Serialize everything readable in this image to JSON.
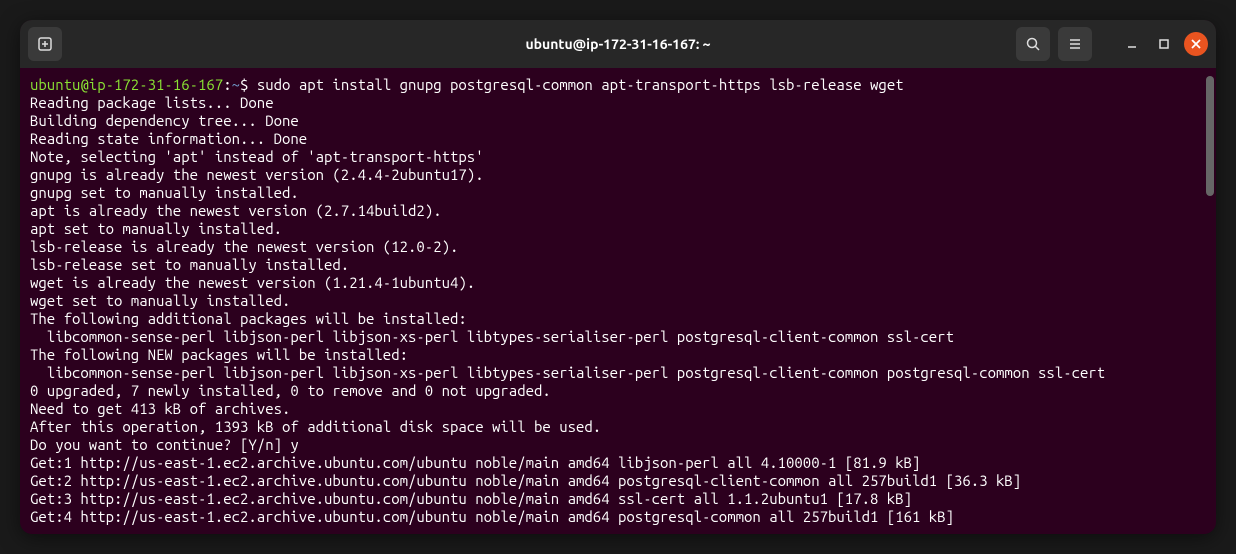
{
  "titlebar": {
    "title": "ubuntu@ip-172-31-16-167: ~"
  },
  "prompt": {
    "user_host": "ubuntu@ip-172-31-16-167",
    "path": "~",
    "symbol": "$"
  },
  "command": "sudo apt install gnupg postgresql-common apt-transport-https lsb-release wget",
  "output": [
    "Reading package lists... Done",
    "Building dependency tree... Done",
    "Reading state information... Done",
    "Note, selecting 'apt' instead of 'apt-transport-https'",
    "gnupg is already the newest version (2.4.4-2ubuntu17).",
    "gnupg set to manually installed.",
    "apt is already the newest version (2.7.14build2).",
    "apt set to manually installed.",
    "lsb-release is already the newest version (12.0-2).",
    "lsb-release set to manually installed.",
    "wget is already the newest version (1.21.4-1ubuntu4).",
    "wget set to manually installed.",
    "The following additional packages will be installed:",
    "  libcommon-sense-perl libjson-perl libjson-xs-perl libtypes-serialiser-perl postgresql-client-common ssl-cert",
    "The following NEW packages will be installed:",
    "  libcommon-sense-perl libjson-perl libjson-xs-perl libtypes-serialiser-perl postgresql-client-common postgresql-common ssl-cert",
    "0 upgraded, 7 newly installed, 0 to remove and 0 not upgraded.",
    "Need to get 413 kB of archives.",
    "After this operation, 1393 kB of additional disk space will be used.",
    "Do you want to continue? [Y/n] y",
    "Get:1 http://us-east-1.ec2.archive.ubuntu.com/ubuntu noble/main amd64 libjson-perl all 4.10000-1 [81.9 kB]",
    "Get:2 http://us-east-1.ec2.archive.ubuntu.com/ubuntu noble/main amd64 postgresql-client-common all 257build1 [36.3 kB]",
    "Get:3 http://us-east-1.ec2.archive.ubuntu.com/ubuntu noble/main amd64 ssl-cert all 1.1.2ubuntu1 [17.8 kB]",
    "Get:4 http://us-east-1.ec2.archive.ubuntu.com/ubuntu noble/main amd64 postgresql-common all 257build1 [161 kB]"
  ]
}
